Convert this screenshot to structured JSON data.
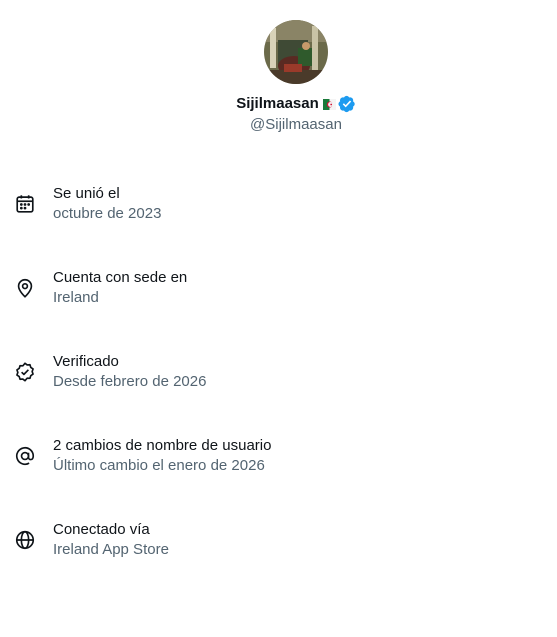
{
  "profile": {
    "display_name": "Sijilmaasan",
    "handle": "@Sijilmaasan",
    "flag": "algeria-flag",
    "verified_badge": "verified-badge-icon",
    "accent_color": "#1d9bf0"
  },
  "about": {
    "items": [
      {
        "icon": "calendar-icon",
        "title": "Se unió el",
        "subtitle": "octubre de 2023"
      },
      {
        "icon": "location-pin-icon",
        "title": "Cuenta con sede en",
        "subtitle": "Ireland"
      },
      {
        "icon": "verified-outline-icon",
        "title": "Verificado",
        "subtitle": "Desde febrero de 2026"
      },
      {
        "icon": "at-sign-icon",
        "title": "2 cambios de nombre de usuario",
        "subtitle": "Último cambio el enero de 2026"
      },
      {
        "icon": "globe-icon",
        "title": "Conectado vía",
        "subtitle": "Ireland App Store"
      }
    ]
  },
  "colors": {
    "primary_text": "#0f1419",
    "secondary_text": "#536471"
  }
}
